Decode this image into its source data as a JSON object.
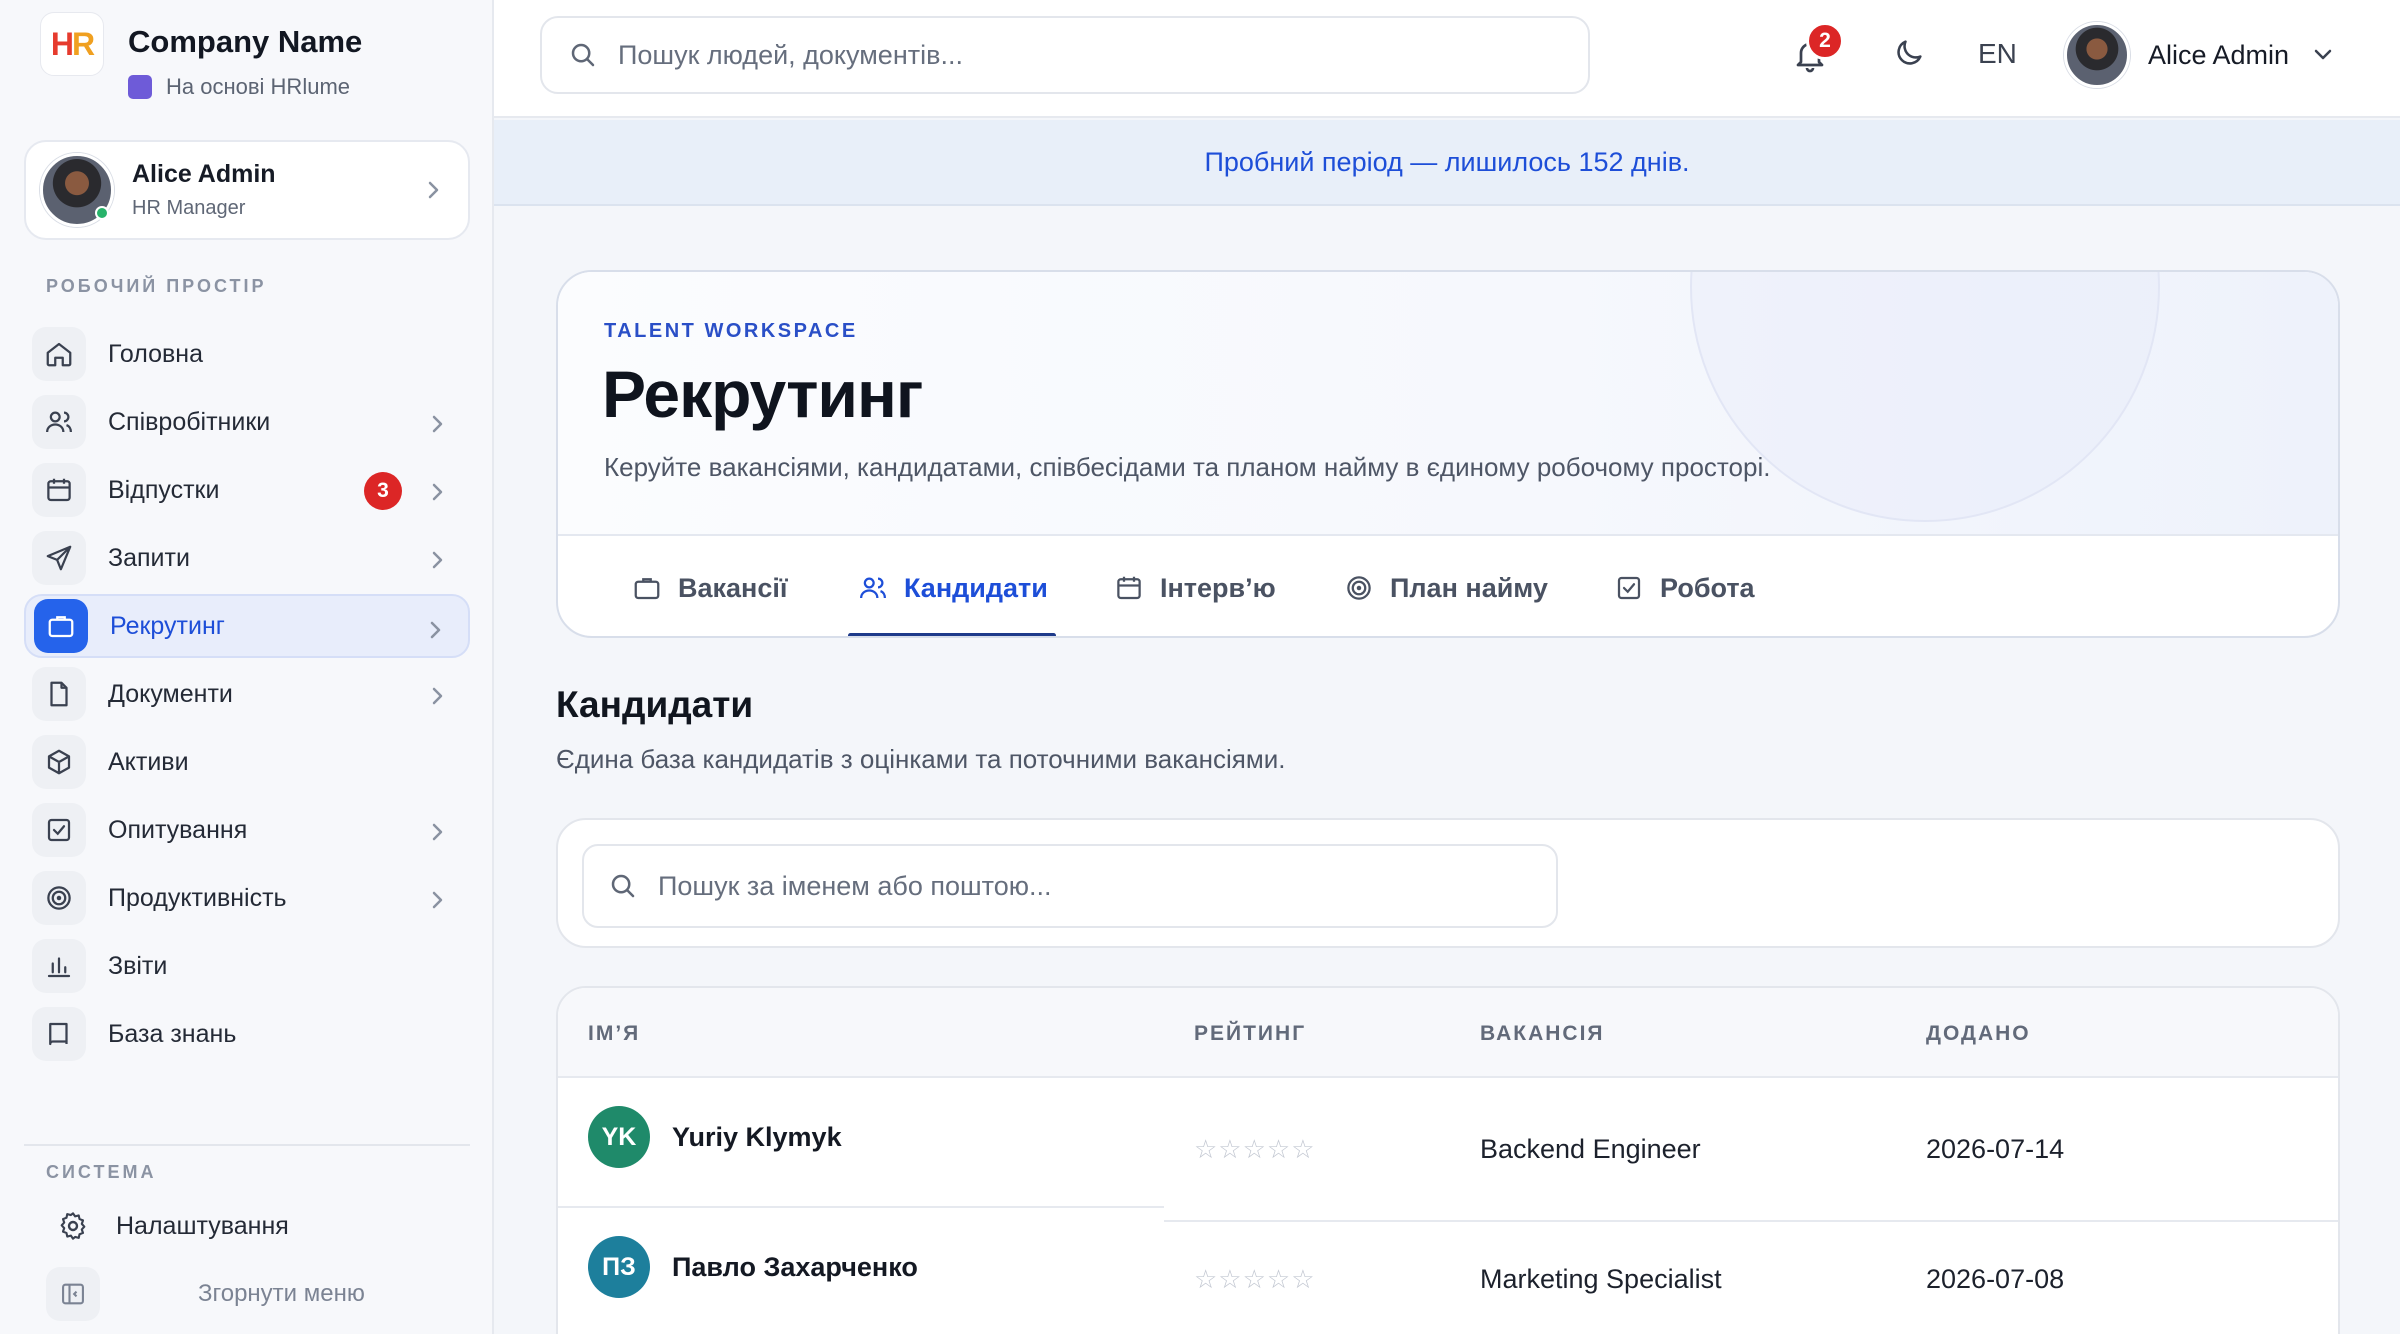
{
  "brand": {
    "name": "Company Name",
    "logo_text_h": "H",
    "logo_text_r": "R",
    "sub": "На основі HRlume"
  },
  "user": {
    "name": "Alice Admin",
    "role": "HR Manager"
  },
  "sidebar": {
    "workspace_label": "РОБОЧИЙ ПРОСТІР",
    "items": [
      {
        "label": "Головна",
        "icon": "home-icon"
      },
      {
        "label": "Співробітники",
        "icon": "users-icon"
      },
      {
        "label": "Відпустки",
        "icon": "calendar-icon",
        "badge": "3"
      },
      {
        "label": "Запити",
        "icon": "send-icon"
      },
      {
        "label": "Рекрутинг",
        "icon": "briefcase-icon"
      },
      {
        "label": "Документи",
        "icon": "document-icon"
      },
      {
        "label": "Активи",
        "icon": "box-icon"
      },
      {
        "label": "Опитування",
        "icon": "checkbox-icon"
      },
      {
        "label": "Продуктивність",
        "icon": "target-icon"
      },
      {
        "label": "Звіти",
        "icon": "bar-chart-icon"
      },
      {
        "label": "База знань",
        "icon": "book-icon"
      }
    ],
    "system_label": "СИСТЕМА",
    "settings_label": "Налаштування",
    "collapse_label": "Згорнути меню"
  },
  "topbar": {
    "search_placeholder": "Пошук людей, документів...",
    "notifications_count": "2",
    "language": "EN",
    "user_name": "Alice Admin"
  },
  "trial_banner": "Пробний період — лишилось 152 днів.",
  "hero": {
    "eyebrow": "TALENT WORKSPACE",
    "title": "Рекрутинг",
    "description": "Керуйте вакансіями, кандидатами, співбесідами та планом найму в єдиному робочому просторі.",
    "tabs": [
      {
        "label": "Вакансії",
        "icon": "briefcase-icon"
      },
      {
        "label": "Кандидати",
        "icon": "users-icon"
      },
      {
        "label": "Інтерв’ю",
        "icon": "calendar-icon"
      },
      {
        "label": "План найму",
        "icon": "target-icon"
      },
      {
        "label": "Робота",
        "icon": "checkbox-icon"
      }
    ],
    "active_tab": "Кандидати"
  },
  "candidates": {
    "title": "Кандидати",
    "description": "Єдина база кандидатів з оцінками та поточними вакансіями.",
    "search_placeholder": "Пошук за іменем або поштою...",
    "columns": [
      "ІМ’Я",
      "РЕЙТИНГ",
      "ВАКАНСІЯ",
      "ДОДАНО"
    ],
    "rows": [
      {
        "initials": "YK",
        "name": "Yuriy Klymyk",
        "rating": 0,
        "stars": "☆☆☆☆☆",
        "vacancy": "Backend Engineer",
        "added": "2026-07-14",
        "color": "#1f8a6a"
      },
      {
        "initials": "ПЗ",
        "name": "Павло Захарченко",
        "rating": 0,
        "stars": "☆☆☆☆☆",
        "vacancy": "Marketing Specialist",
        "added": "2026-07-08",
        "color": "#1d7f9c"
      }
    ]
  },
  "colors": {
    "accent": "#2563eb",
    "badge": "#dc2626",
    "banner_text": "#1d4ed8"
  }
}
